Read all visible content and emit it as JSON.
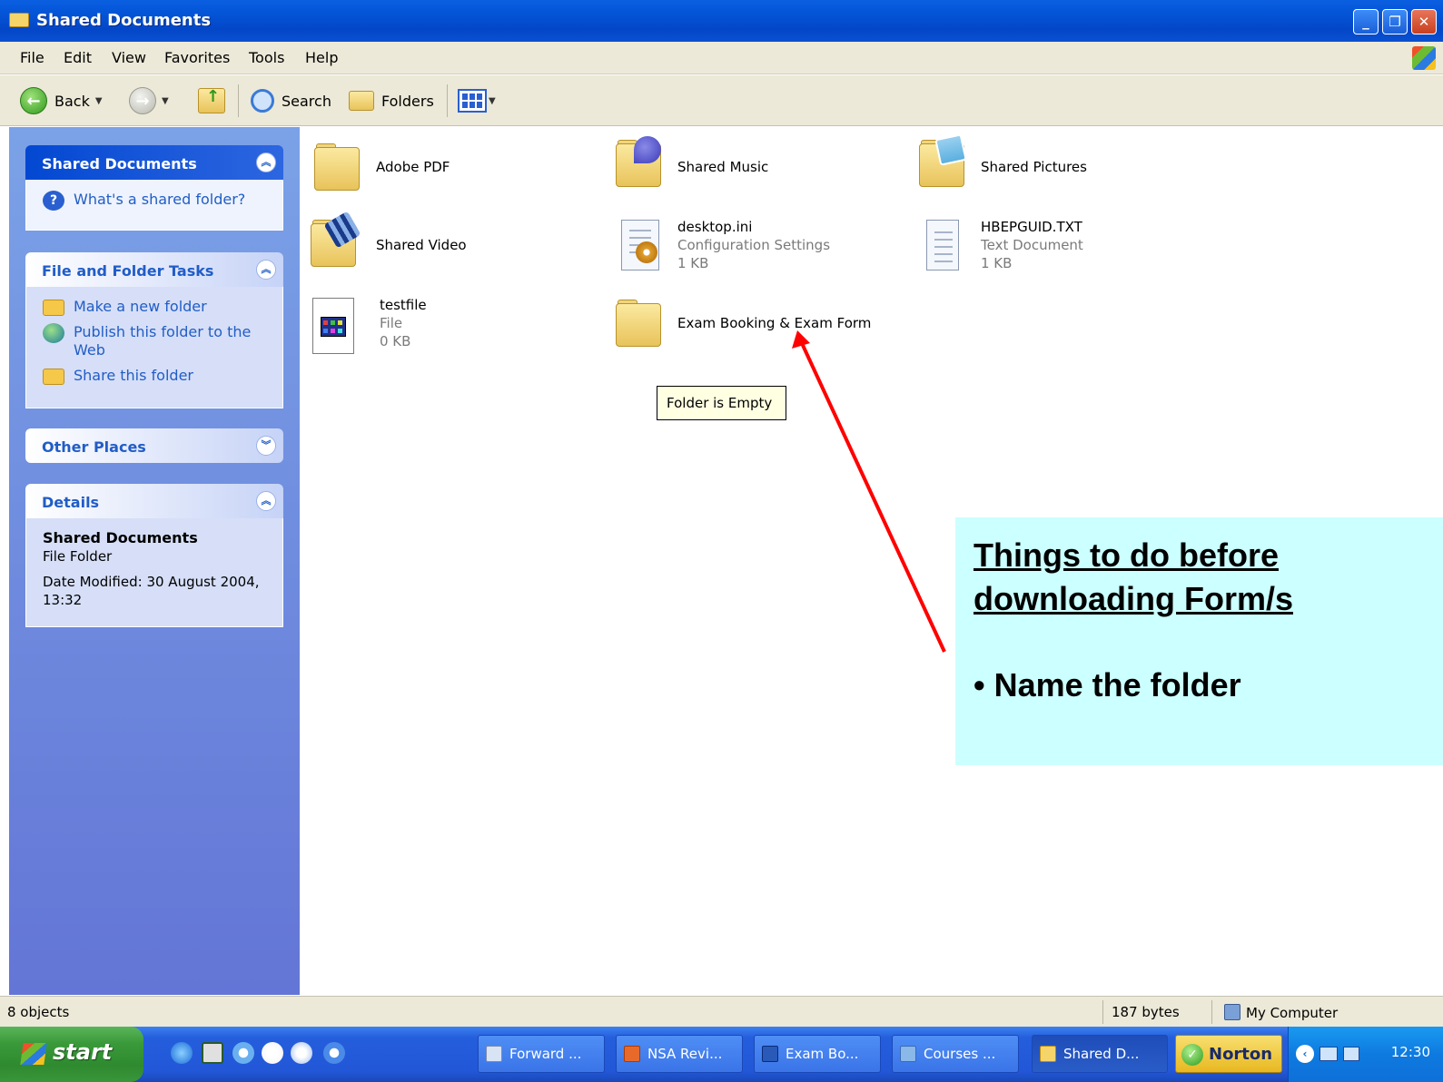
{
  "window": {
    "title": "Shared Documents"
  },
  "menu": [
    "File",
    "Edit",
    "View",
    "Favorites",
    "Tools",
    "Help"
  ],
  "toolbar": {
    "back_label": "Back",
    "search_label": "Search",
    "folders_label": "Folders"
  },
  "task_pane": {
    "shared_documents": {
      "title": "Shared Documents",
      "help_link": "What's a shared folder?"
    },
    "file_folder_tasks": {
      "title": "File and Folder Tasks",
      "tasks": [
        "Make a new folder",
        "Publish this folder to the Web",
        "Share this folder"
      ]
    },
    "other_places": {
      "title": "Other Places"
    },
    "details": {
      "title": "Details",
      "name": "Shared Documents",
      "type": "File Folder",
      "modified": "Date Modified: 30 August 2004, 13:32"
    }
  },
  "items": [
    {
      "name": "Adobe PDF",
      "icon": "folder-icon"
    },
    {
      "name": "Shared Music",
      "icon": "music-folder-icon"
    },
    {
      "name": "Shared Pictures",
      "icon": "pictures-folder-icon"
    },
    {
      "name": "Shared Video",
      "icon": "video-folder-icon"
    },
    {
      "name": "desktop.ini",
      "type": "Configuration Settings",
      "size": "1 KB",
      "icon": "config-file-icon"
    },
    {
      "name": "HBEPGUID.TXT",
      "type": "Text Document",
      "size": "1 KB",
      "icon": "text-file-icon"
    },
    {
      "name": "testfile",
      "type": "File",
      "size": "0 KB",
      "icon": "file-icon"
    },
    {
      "name": "Exam Booking & Exam Form",
      "icon": "folder-icon"
    }
  ],
  "tooltip": "Folder is Empty",
  "callout": {
    "heading": "Things to do before downloading Form/s",
    "bullet": "• Name the folder"
  },
  "status": {
    "objects": "8 objects",
    "size": "187 bytes",
    "zone": "My Computer"
  },
  "taskbar": {
    "start": "start",
    "buttons": [
      "Forward ...",
      "NSA Revi...",
      "Exam Bo...",
      "Courses ...",
      "Shared D..."
    ],
    "norton": "Norton",
    "clock": "12:30"
  },
  "colors": {
    "titlebar": "#0455d8",
    "taskpane": "#7ba2e7",
    "callout_bg": "#ccffff",
    "arrow": "#ff0000"
  }
}
